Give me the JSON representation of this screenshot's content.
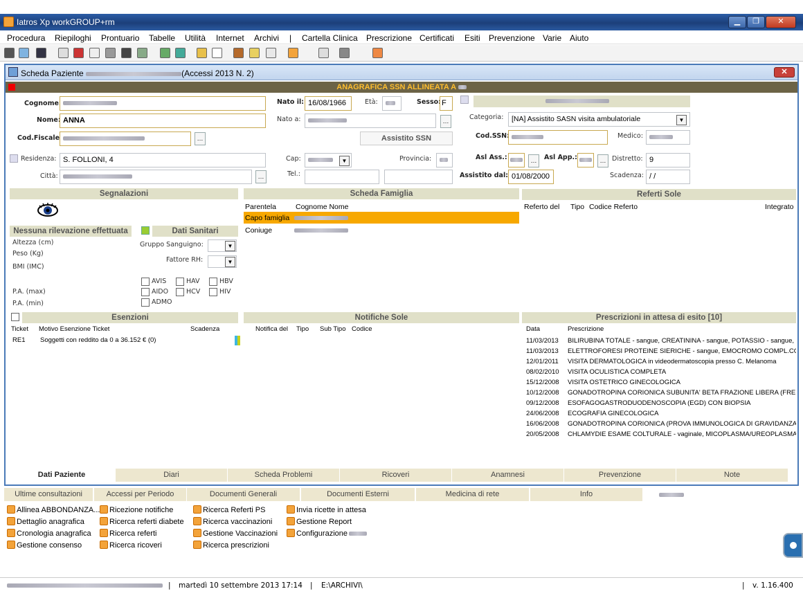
{
  "window": {
    "title": "Iatros Xp workGROUP+rm"
  },
  "menu": [
    "Procedura",
    "Riepiloghi",
    "Prontuario",
    "Tabelle",
    "Utilità",
    "Internet",
    "Archivi",
    "|",
    "Cartella Clinica",
    "Prescrizione",
    "Certificati",
    "Esiti",
    "Prevenzione",
    "Varie",
    "Aiuto"
  ],
  "scheda": {
    "title": "Scheda Paziente",
    "accessi": "(Accessi 2013 N. 2)",
    "banner": "ANAGRAFICA SSN ALLINEATA A",
    "labels": {
      "cognome": "Cognome:",
      "nome": "Nome:",
      "codfisc": "Cod.Fiscale:",
      "residenza": "Residenza:",
      "citta": "Città:",
      "natoil": "Nato il:",
      "eta": "Età:",
      "sesso": "Sesso:",
      "natoa": "Nato a:",
      "cap": "Cap:",
      "provincia": "Provincia:",
      "tel": "Tel.:",
      "categoria": "Categoria:",
      "codssn": "Cod.SSN:",
      "medico": "Medico:",
      "aslass": "Asl Ass.:",
      "aslapp": "Asl App.:",
      "distretto": "Distretto:",
      "assistitodal": "Assistito dal:",
      "scadenza": "Scadenza:",
      "assistitossn": "Assistito SSN"
    },
    "values": {
      "nome": "ANNA",
      "natoil": "16/08/1966",
      "sesso": "F",
      "residenza": "S. FOLLONI, 4",
      "categoria": "[NA] Assistito SASN visita ambulatoriale",
      "distretto": "9",
      "assistitodal": "01/08/2000",
      "scadenza": "/ /"
    }
  },
  "segnalazioni": {
    "header": "Segnalazioni",
    "nessuna": "Nessuna rilevazione effettuata",
    "datisanitari": "Dati Sanitari",
    "altezza": "Altezza (cm)",
    "peso": "Peso (Kg)",
    "bmi": "BMI (IMC)",
    "pamax": "P.A. (max)",
    "pamin": "P.A. (min)",
    "gruppo": "Gruppo Sanguigno:",
    "fattore": "Fattore RH:",
    "checks": [
      "AVIS",
      "HAV",
      "HBV",
      "AIDO",
      "HCV",
      "HIV",
      "ADMO"
    ]
  },
  "famiglia": {
    "header": "Scheda Famiglia",
    "col_parentela": "Parentela",
    "col_cognome": "Cognome Nome",
    "rows": [
      "Capo famiglia",
      "Coniuge"
    ]
  },
  "referti": {
    "header": "Referti Sole",
    "cols": [
      "Referto del",
      "Tipo",
      "Codice Referto",
      "Integrato"
    ]
  },
  "esenzioni": {
    "header": "Esenzioni",
    "cols": [
      "Ticket",
      "Motivo Esenzione Ticket",
      "Scadenza"
    ],
    "rows": [
      {
        "ticket": "RE1",
        "motivo": "Soggetti con reddito da 0 a 36.152 € (0)"
      }
    ]
  },
  "notifiche": {
    "header": "Notifiche Sole",
    "cols": [
      "Notifica del",
      "Tipo",
      "Sub Tipo",
      "Codice"
    ]
  },
  "prescrizioni": {
    "header": "Prescrizioni in attesa di esito [10]",
    "col_data": "Data",
    "col_presc": "Prescrizione",
    "rows": [
      {
        "d": "11/03/2013",
        "p": "BILIRUBINA TOTALE - sangue, CREATININA - sangue, POTASSIO - sangue, S"
      },
      {
        "d": "11/03/2013",
        "p": "ELETTROFORESI PROTEINE SIERICHE - sangue, EMOCROMO COMPL.CON"
      },
      {
        "d": "12/01/2011",
        "p": "VISITA DERMATOLOGICA in videodermatoscopia presso C. Melanoma"
      },
      {
        "d": "08/02/2010",
        "p": "VISITA OCULISTICA COMPLETA"
      },
      {
        "d": "15/12/2008",
        "p": "VISITA OSTETRICO GINECOLOGICA"
      },
      {
        "d": "10/12/2008",
        "p": "GONADOTROPINA CORIONICA SUBUNITA' BETA FRAZIONE LIBERA (FREE"
      },
      {
        "d": "09/12/2008",
        "p": "ESOFAGOGASTRODUODENOSCOPIA (EGD) CON BIOPSIA"
      },
      {
        "d": "24/06/2008",
        "p": "ECOGRAFIA GINECOLOGICA"
      },
      {
        "d": "16/06/2008",
        "p": "GONADOTROPINA CORIONICA (PROVA IMMUNOLOGICA DI GRAVIDANZA)"
      },
      {
        "d": "20/05/2008",
        "p": "CHLAMYDIE ESAME COLTURALE - vaginale, MICOPLASMA/UREOPLASMA E"
      }
    ]
  },
  "tabs": [
    "Dati Paziente",
    "Diari",
    "Scheda Problemi",
    "Ricoveri",
    "Anamnesi",
    "Prevenzione",
    "Note"
  ],
  "tabs2": [
    "Ultime consultazioni",
    "Accessi per Periodo",
    "Documenti Generali",
    "Documenti Esterni",
    "Medicina di rete",
    "Info"
  ],
  "links": {
    "c1": [
      "Allinea ABBONDANZA...",
      "Dettaglio anagrafica",
      "Cronologia anagrafica",
      "Gestione consenso"
    ],
    "c2": [
      "Ricezione notifiche",
      "Ricerca referti diabete",
      "Ricerca referti",
      "Ricerca ricoveri"
    ],
    "c3": [
      "Ricerca Referti PS",
      "Ricerca vaccinazioni",
      "Gestione Vaccinazioni",
      "Ricerca prescrizioni"
    ],
    "c4": [
      "Invia ricette in attesa",
      "Gestione Report",
      "Configurazione"
    ]
  },
  "status": {
    "datetime": "martedì 10 settembre 2013   17:14",
    "path": "E:\\ARCHIVI\\",
    "version": "v. 1.16.400"
  }
}
